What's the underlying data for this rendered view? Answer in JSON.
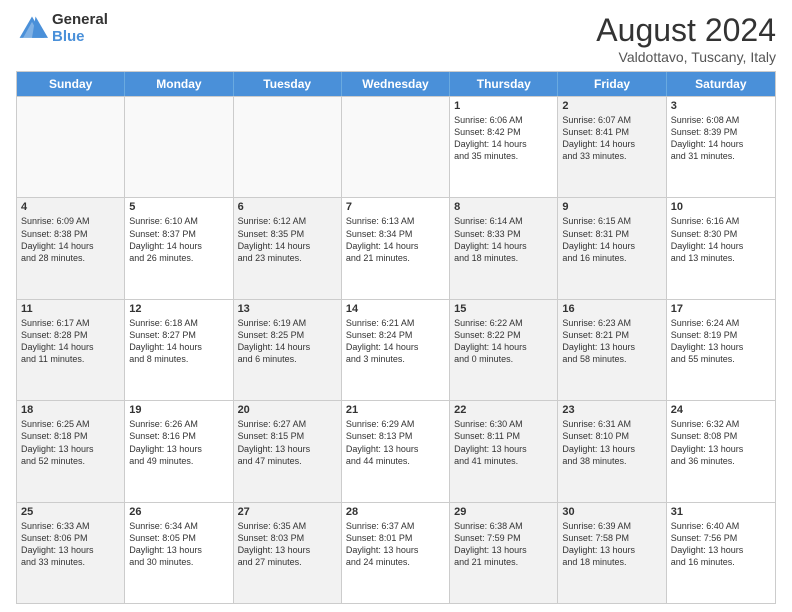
{
  "header": {
    "logo_general": "General",
    "logo_blue": "Blue",
    "month_title": "August 2024",
    "location": "Valdottavo, Tuscany, Italy"
  },
  "calendar": {
    "days_of_week": [
      "Sunday",
      "Monday",
      "Tuesday",
      "Wednesday",
      "Thursday",
      "Friday",
      "Saturday"
    ],
    "weeks": [
      [
        {
          "day": "",
          "empty": true
        },
        {
          "day": "",
          "empty": true
        },
        {
          "day": "",
          "empty": true
        },
        {
          "day": "",
          "empty": true
        },
        {
          "day": "1",
          "text": "Sunrise: 6:06 AM\nSunset: 8:42 PM\nDaylight: 14 hours\nand 35 minutes."
        },
        {
          "day": "2",
          "text": "Sunrise: 6:07 AM\nSunset: 8:41 PM\nDaylight: 14 hours\nand 33 minutes.",
          "shaded": true
        },
        {
          "day": "3",
          "text": "Sunrise: 6:08 AM\nSunset: 8:39 PM\nDaylight: 14 hours\nand 31 minutes."
        }
      ],
      [
        {
          "day": "4",
          "shaded": true,
          "text": "Sunrise: 6:09 AM\nSunset: 8:38 PM\nDaylight: 14 hours\nand 28 minutes."
        },
        {
          "day": "5",
          "text": "Sunrise: 6:10 AM\nSunset: 8:37 PM\nDaylight: 14 hours\nand 26 minutes."
        },
        {
          "day": "6",
          "shaded": true,
          "text": "Sunrise: 6:12 AM\nSunset: 8:35 PM\nDaylight: 14 hours\nand 23 minutes."
        },
        {
          "day": "7",
          "text": "Sunrise: 6:13 AM\nSunset: 8:34 PM\nDaylight: 14 hours\nand 21 minutes."
        },
        {
          "day": "8",
          "shaded": true,
          "text": "Sunrise: 6:14 AM\nSunset: 8:33 PM\nDaylight: 14 hours\nand 18 minutes."
        },
        {
          "day": "9",
          "text": "Sunrise: 6:15 AM\nSunset: 8:31 PM\nDaylight: 14 hours\nand 16 minutes.",
          "shaded": true
        },
        {
          "day": "10",
          "text": "Sunrise: 6:16 AM\nSunset: 8:30 PM\nDaylight: 14 hours\nand 13 minutes."
        }
      ],
      [
        {
          "day": "11",
          "shaded": true,
          "text": "Sunrise: 6:17 AM\nSunset: 8:28 PM\nDaylight: 14 hours\nand 11 minutes."
        },
        {
          "day": "12",
          "text": "Sunrise: 6:18 AM\nSunset: 8:27 PM\nDaylight: 14 hours\nand 8 minutes."
        },
        {
          "day": "13",
          "shaded": true,
          "text": "Sunrise: 6:19 AM\nSunset: 8:25 PM\nDaylight: 14 hours\nand 6 minutes."
        },
        {
          "day": "14",
          "text": "Sunrise: 6:21 AM\nSunset: 8:24 PM\nDaylight: 14 hours\nand 3 minutes."
        },
        {
          "day": "15",
          "shaded": true,
          "text": "Sunrise: 6:22 AM\nSunset: 8:22 PM\nDaylight: 14 hours\nand 0 minutes."
        },
        {
          "day": "16",
          "text": "Sunrise: 6:23 AM\nSunset: 8:21 PM\nDaylight: 13 hours\nand 58 minutes.",
          "shaded": true
        },
        {
          "day": "17",
          "text": "Sunrise: 6:24 AM\nSunset: 8:19 PM\nDaylight: 13 hours\nand 55 minutes."
        }
      ],
      [
        {
          "day": "18",
          "shaded": true,
          "text": "Sunrise: 6:25 AM\nSunset: 8:18 PM\nDaylight: 13 hours\nand 52 minutes."
        },
        {
          "day": "19",
          "text": "Sunrise: 6:26 AM\nSunset: 8:16 PM\nDaylight: 13 hours\nand 49 minutes."
        },
        {
          "day": "20",
          "shaded": true,
          "text": "Sunrise: 6:27 AM\nSunset: 8:15 PM\nDaylight: 13 hours\nand 47 minutes."
        },
        {
          "day": "21",
          "text": "Sunrise: 6:29 AM\nSunset: 8:13 PM\nDaylight: 13 hours\nand 44 minutes."
        },
        {
          "day": "22",
          "shaded": true,
          "text": "Sunrise: 6:30 AM\nSunset: 8:11 PM\nDaylight: 13 hours\nand 41 minutes."
        },
        {
          "day": "23",
          "text": "Sunrise: 6:31 AM\nSunset: 8:10 PM\nDaylight: 13 hours\nand 38 minutes.",
          "shaded": true
        },
        {
          "day": "24",
          "text": "Sunrise: 6:32 AM\nSunset: 8:08 PM\nDaylight: 13 hours\nand 36 minutes."
        }
      ],
      [
        {
          "day": "25",
          "shaded": true,
          "text": "Sunrise: 6:33 AM\nSunset: 8:06 PM\nDaylight: 13 hours\nand 33 minutes."
        },
        {
          "day": "26",
          "text": "Sunrise: 6:34 AM\nSunset: 8:05 PM\nDaylight: 13 hours\nand 30 minutes."
        },
        {
          "day": "27",
          "shaded": true,
          "text": "Sunrise: 6:35 AM\nSunset: 8:03 PM\nDaylight: 13 hours\nand 27 minutes."
        },
        {
          "day": "28",
          "text": "Sunrise: 6:37 AM\nSunset: 8:01 PM\nDaylight: 13 hours\nand 24 minutes."
        },
        {
          "day": "29",
          "shaded": true,
          "text": "Sunrise: 6:38 AM\nSunset: 7:59 PM\nDaylight: 13 hours\nand 21 minutes."
        },
        {
          "day": "30",
          "text": "Sunrise: 6:39 AM\nSunset: 7:58 PM\nDaylight: 13 hours\nand 18 minutes.",
          "shaded": true
        },
        {
          "day": "31",
          "text": "Sunrise: 6:40 AM\nSunset: 7:56 PM\nDaylight: 13 hours\nand 16 minutes."
        }
      ]
    ]
  }
}
